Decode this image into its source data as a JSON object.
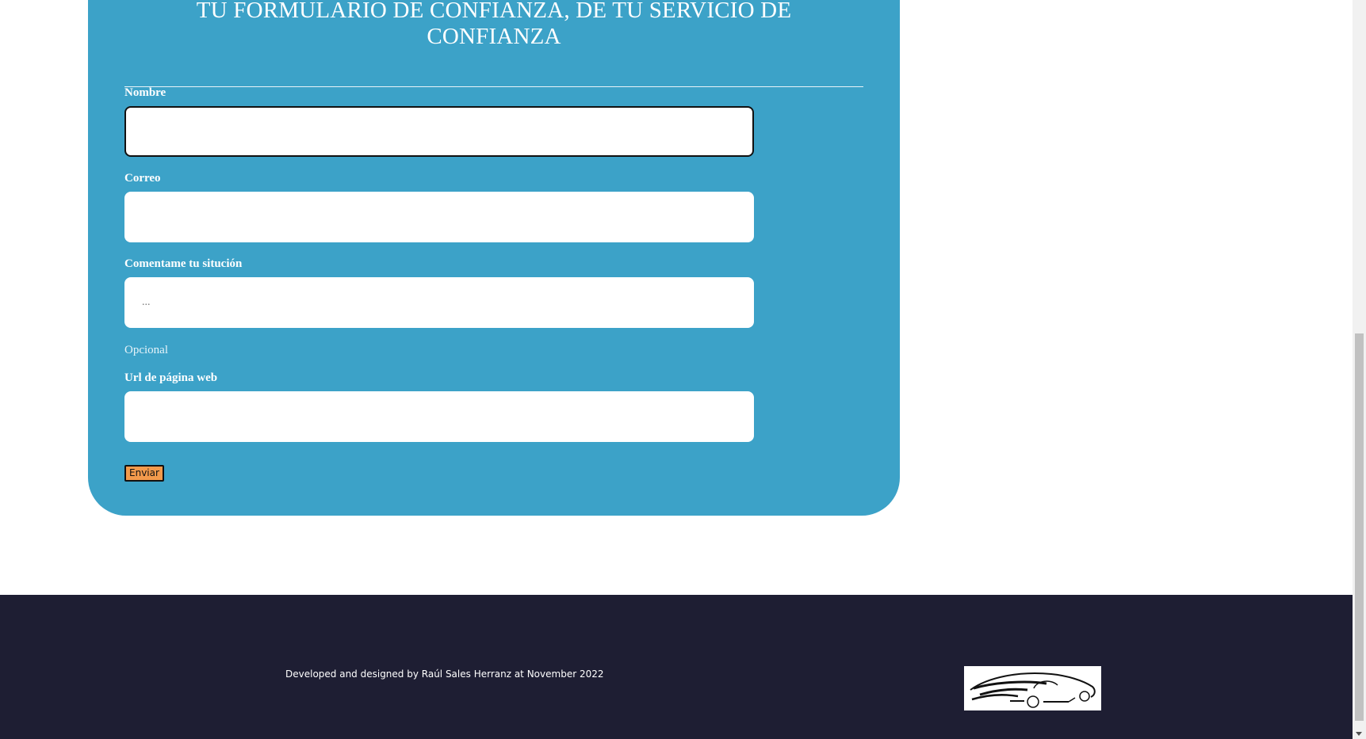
{
  "form": {
    "title_line1": "TU FORMULARIO DE CONFIANZA, DE TU SERVICIO DE",
    "title_line2": "CONFIANZA",
    "fields": {
      "nombre": {
        "label": "Nombre",
        "value": "",
        "placeholder": ""
      },
      "correo": {
        "label": "Correo",
        "value": "",
        "placeholder": ""
      },
      "situacion": {
        "label": "Comentame tu situción",
        "value": "",
        "placeholder": "...",
        "helper": "Opcional"
      },
      "url": {
        "label": "Url de página web",
        "value": "",
        "placeholder": ""
      }
    },
    "submit_label": "Enviar"
  },
  "footer": {
    "credit": "Developed and designed by Raúl Sales Herranz at November 2022",
    "logo_icon": "car-sketch-logo"
  },
  "colors": {
    "card_background": "#3ca2c8",
    "footer_background": "#1e1e33",
    "submit_button": "#f39a4c"
  }
}
